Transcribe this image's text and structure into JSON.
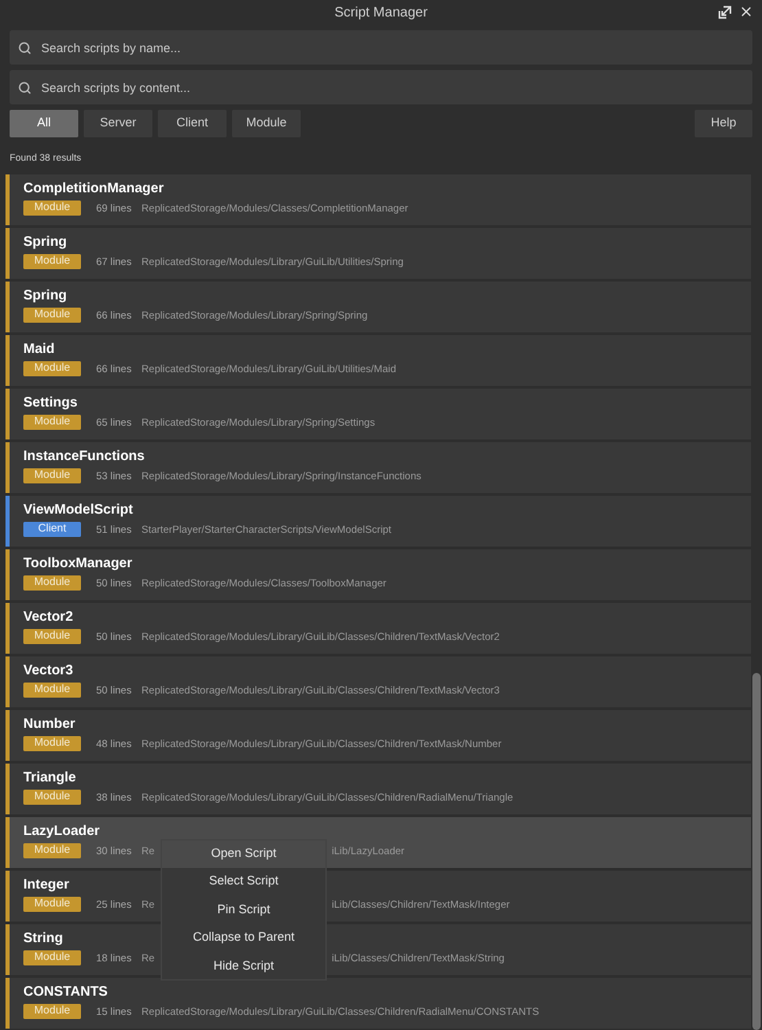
{
  "window": {
    "title": "Script Manager"
  },
  "search_fields": [
    {
      "placeholder": "Search scripts by name..."
    },
    {
      "placeholder": "Search scripts by content..."
    }
  ],
  "filters": [
    {
      "label": "All",
      "selected": true
    },
    {
      "label": "Server",
      "selected": false
    },
    {
      "label": "Client",
      "selected": false
    },
    {
      "label": "Module",
      "selected": false
    }
  ],
  "help_button": "Help",
  "result_count": "Found 38 results",
  "scripts": [
    {
      "name": "CompletitionManager",
      "kind": "module",
      "badge": "Module",
      "lines": "69 lines",
      "path": "ReplicatedStorage/Modules/Classes/CompletitionManager",
      "selected": false
    },
    {
      "name": "Spring",
      "kind": "module",
      "badge": "Module",
      "lines": "67 lines",
      "path": "ReplicatedStorage/Modules/Library/GuiLib/Utilities/Spring",
      "selected": false
    },
    {
      "name": "Spring",
      "kind": "module",
      "badge": "Module",
      "lines": "66 lines",
      "path": "ReplicatedStorage/Modules/Library/Spring/Spring",
      "selected": false
    },
    {
      "name": "Maid",
      "kind": "module",
      "badge": "Module",
      "lines": "66 lines",
      "path": "ReplicatedStorage/Modules/Library/GuiLib/Utilities/Maid",
      "selected": false
    },
    {
      "name": "Settings",
      "kind": "module",
      "badge": "Module",
      "lines": "65 lines",
      "path": "ReplicatedStorage/Modules/Library/Spring/Settings",
      "selected": false
    },
    {
      "name": "InstanceFunctions",
      "kind": "module",
      "badge": "Module",
      "lines": "53 lines",
      "path": "ReplicatedStorage/Modules/Library/Spring/InstanceFunctions",
      "selected": false
    },
    {
      "name": "ViewModelScript",
      "kind": "client",
      "badge": "Client",
      "lines": "51 lines",
      "path": "StarterPlayer/StarterCharacterScripts/ViewModelScript",
      "selected": false
    },
    {
      "name": "ToolboxManager",
      "kind": "module",
      "badge": "Module",
      "lines": "50 lines",
      "path": "ReplicatedStorage/Modules/Classes/ToolboxManager",
      "selected": false
    },
    {
      "name": "Vector2",
      "kind": "module",
      "badge": "Module",
      "lines": "50 lines",
      "path": "ReplicatedStorage/Modules/Library/GuiLib/Classes/Children/TextMask/Vector2",
      "selected": false
    },
    {
      "name": "Vector3",
      "kind": "module",
      "badge": "Module",
      "lines": "50 lines",
      "path": "ReplicatedStorage/Modules/Library/GuiLib/Classes/Children/TextMask/Vector3",
      "selected": false
    },
    {
      "name": "Number",
      "kind": "module",
      "badge": "Module",
      "lines": "48 lines",
      "path": "ReplicatedStorage/Modules/Library/GuiLib/Classes/Children/TextMask/Number",
      "selected": false
    },
    {
      "name": "Triangle",
      "kind": "module",
      "badge": "Module",
      "lines": "38 lines",
      "path": "ReplicatedStorage/Modules/Library/GuiLib/Classes/Children/RadialMenu/Triangle",
      "selected": false
    },
    {
      "name": "LazyLoader",
      "kind": "module",
      "badge": "Module",
      "lines": "30 lines",
      "path": "Re",
      "path_end": "iLib/LazyLoader",
      "selected": true
    },
    {
      "name": "Integer",
      "kind": "module",
      "badge": "Module",
      "lines": "25 lines",
      "path": "Re",
      "path_end": "iLib/Classes/Children/TextMask/Integer",
      "selected": false
    },
    {
      "name": "String",
      "kind": "module",
      "badge": "Module",
      "lines": "18 lines",
      "path": "Re",
      "path_end": "iLib/Classes/Children/TextMask/String",
      "selected": false
    },
    {
      "name": "CONSTANTS",
      "kind": "module",
      "badge": "Module",
      "lines": "15 lines",
      "path": "ReplicatedStorage/Modules/Library/GuiLib/Classes/Children/RadialMenu/CONSTANTS",
      "selected": false
    }
  ],
  "context_menu": [
    {
      "label": "Open Script",
      "selected": true
    },
    {
      "label": "Select Script",
      "selected": false
    },
    {
      "label": "Pin Script",
      "selected": false
    },
    {
      "label": "Collapse to Parent",
      "selected": false
    },
    {
      "label": "Hide Script",
      "selected": false
    }
  ]
}
